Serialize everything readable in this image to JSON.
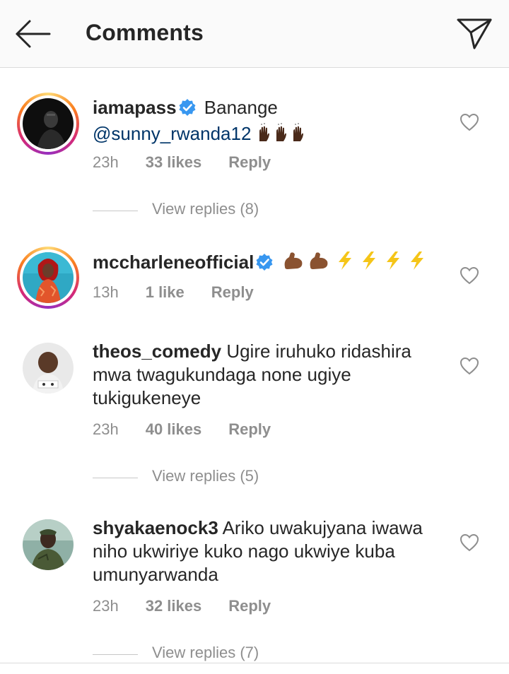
{
  "header": {
    "title": "Comments",
    "back_icon": "arrow-left-icon",
    "send_icon": "paper-plane-icon"
  },
  "comments": [
    {
      "username": "iamapass",
      "verified": true,
      "text_before": "Banange",
      "mention": "@sunny_rwanda12",
      "emoji": "👐🏿👐🏿👐🏿",
      "time": "23h",
      "likes": "33 likes",
      "reply": "Reply",
      "view_replies": "View replies (8)"
    },
    {
      "username": "mccharleneofficial",
      "verified": true,
      "emoji": "💪🏾💪🏾⚡⚡⚡⚡",
      "time": "13h",
      "likes": "1 like",
      "reply": "Reply"
    },
    {
      "username": "theos_comedy",
      "verified": false,
      "text": "Ugire iruhuko ridashira mwa twagukundaga none ugiye tukigukeneye",
      "time": "23h",
      "likes": "40 likes",
      "reply": "Reply",
      "view_replies": "View replies (5)"
    },
    {
      "username": "shyakaenock3",
      "verified": false,
      "text": "Ariko uwakujyana iwawa niho ukwiriye kuko nago ukwiye kuba umunyarwanda",
      "time": "23h",
      "likes": "32 likes",
      "reply": "Reply",
      "view_replies": "View replies (7)"
    }
  ],
  "colors": {
    "mention": "#003569",
    "verified": "#3897f0",
    "meta": "#8e8e8e"
  }
}
